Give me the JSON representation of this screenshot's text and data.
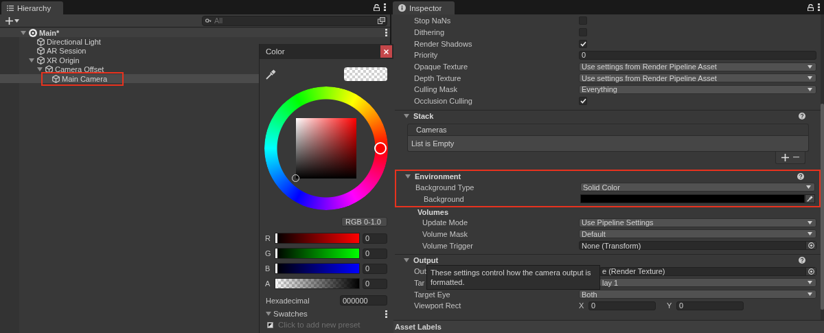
{
  "hierarchy": {
    "tab": "Hierarchy",
    "search": {
      "placeholder": "All"
    },
    "tree": [
      {
        "label": "Main*",
        "kind": "scene",
        "selected": false,
        "outlined": false,
        "expanded": true,
        "children": [
          {
            "label": "Directional Light",
            "kind": "object",
            "selected": false,
            "outlined": false
          },
          {
            "label": "AR Session",
            "kind": "object",
            "selected": false,
            "outlined": false
          },
          {
            "label": "XR Origin",
            "kind": "object",
            "selected": false,
            "outlined": false,
            "expanded": true,
            "children": [
              {
                "label": "Camera Offset",
                "kind": "object",
                "selected": false,
                "outlined": false,
                "expanded": true,
                "children": [
                  {
                    "label": "Main Camera",
                    "kind": "object",
                    "selected": true,
                    "outlined": true
                  }
                ]
              }
            ]
          }
        ]
      }
    ]
  },
  "color_picker": {
    "title": "Color",
    "mode": "RGB 0-1.0",
    "channels": [
      {
        "label": "R",
        "kind": "red",
        "level": 0,
        "value": "0"
      },
      {
        "label": "G",
        "kind": "green",
        "level": 0,
        "value": "0"
      },
      {
        "label": "B",
        "kind": "blue",
        "level": 0,
        "value": "0"
      },
      {
        "label": "A",
        "kind": "alpha",
        "level": 0,
        "value": "0"
      }
    ],
    "hex_label": "Hexadecimal",
    "hex": "000000",
    "swatches": {
      "title": "Swatches",
      "expanded": true,
      "hint": "Click to add new preset"
    }
  },
  "inspector": {
    "tab": "Inspector",
    "groups": [
      {
        "kind": "plain",
        "rows": [
          {
            "label": "Stop NaNs",
            "kind": "checkbox",
            "checked": false
          },
          {
            "label": "Dithering",
            "kind": "checkbox",
            "checked": false
          },
          {
            "label": "Render Shadows",
            "kind": "checkbox",
            "checked": true
          },
          {
            "label": "Priority",
            "kind": "number",
            "value": "0"
          },
          {
            "label": "Opaque Texture",
            "kind": "dropdown",
            "value": "Use settings from Render Pipeline Asset"
          },
          {
            "label": "Depth Texture",
            "kind": "dropdown",
            "value": "Use settings from Render Pipeline Asset"
          },
          {
            "label": "Culling Mask",
            "kind": "dropdown",
            "value": "Everything"
          },
          {
            "label": "Occlusion Culling",
            "kind": "checkbox",
            "checked": true
          }
        ]
      },
      {
        "kind": "section",
        "title": "Stack",
        "expanded": true,
        "outlined": false,
        "list": {
          "header": "Cameras",
          "empty_text": "List is Empty"
        }
      },
      {
        "kind": "section",
        "title": "Environment",
        "expanded": true,
        "outlined": true,
        "rows": [
          {
            "label": "Background Type",
            "kind": "dropdown",
            "value": "Solid Color",
            "children": [
              {
                "label": "Background",
                "kind": "color",
                "color": "#000000"
              }
            ]
          }
        ]
      },
      {
        "kind": "subgroup",
        "title": "Volumes",
        "rows": [
          {
            "label": "Update Mode",
            "kind": "dropdown",
            "value": "Use Pipeline Settings"
          },
          {
            "label": "Volume Mask",
            "kind": "dropdown",
            "value": "Default"
          },
          {
            "label": "Volume Trigger",
            "kind": "object",
            "value": "None (Transform)"
          }
        ]
      },
      {
        "kind": "section",
        "title": "Output",
        "expanded": true,
        "outlined": false,
        "tooltip": "These settings control how the camera output is formatted.",
        "rows": [
          {
            "label": "Out",
            "kind": "object",
            "value": "e (Render Texture)",
            "covered": true
          },
          {
            "label": "Tar",
            "kind": "dropdown",
            "value": "lay 1",
            "covered": true
          },
          {
            "label": "Target Eye",
            "kind": "dropdown",
            "value": "Both"
          },
          {
            "label": "Viewport Rect",
            "kind": "vector",
            "fields": [
              {
                "axis": "X",
                "value": "0"
              },
              {
                "axis": "Y",
                "value": "0"
              }
            ]
          }
        ]
      }
    ],
    "footer": "Asset Labels"
  }
}
